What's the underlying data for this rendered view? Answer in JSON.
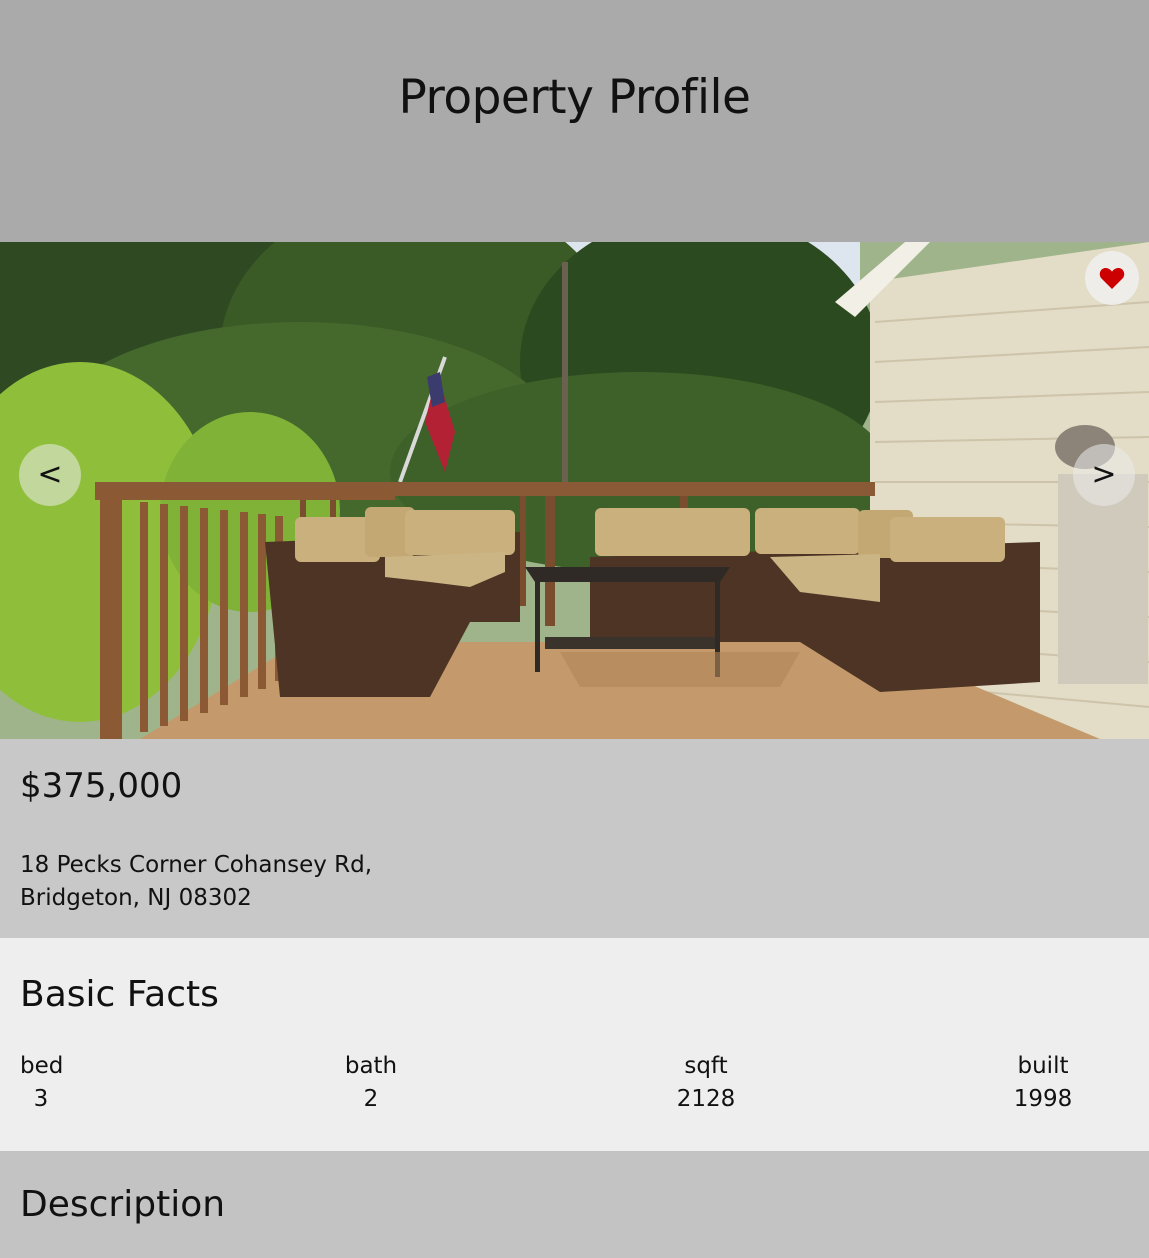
{
  "header": {
    "title": "Property Profile"
  },
  "gallery": {
    "prev_label": "<",
    "next_label": ">",
    "favorite_color": "#cc0000"
  },
  "listing": {
    "price": "$375,000",
    "address_line1": "18 Pecks Corner Cohansey Rd,",
    "address_line2": "Bridgeton, NJ 08302"
  },
  "basic_facts": {
    "heading": "Basic Facts",
    "items": [
      {
        "label": "bed",
        "value": "3"
      },
      {
        "label": "bath",
        "value": "2"
      },
      {
        "label": "sqft",
        "value": "2128"
      },
      {
        "label": "built",
        "value": "1998"
      }
    ]
  },
  "description": {
    "heading": "Description"
  }
}
